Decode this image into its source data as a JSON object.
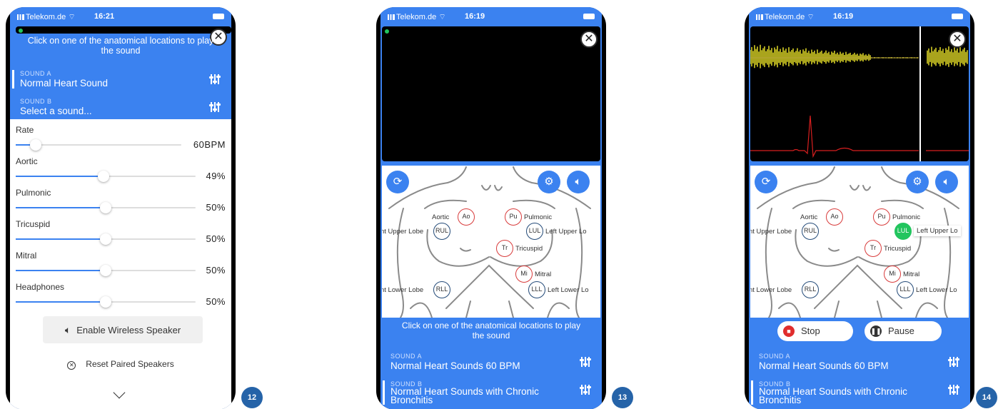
{
  "colors": {
    "accent": "#3b82f0",
    "badge": "#2563a8",
    "active_location": "#22c55e",
    "stop": "#e02d2d"
  },
  "screen12": {
    "status": {
      "carrier": "Telekom.de",
      "time": "16:21"
    },
    "instruction": "Click on one of the anatomical locations to play the sound",
    "sound_a": {
      "label": "SOUND A",
      "value": "Normal Heart Sound"
    },
    "sound_b": {
      "label": "SOUND B",
      "value": "Select a sound..."
    },
    "sliders": [
      {
        "label": "Rate",
        "value": "60BPM",
        "level": 0.12
      },
      {
        "label": "Aortic",
        "value": "49%",
        "level": 0.49
      },
      {
        "label": "Pulmonic",
        "value": "50%",
        "level": 0.5
      },
      {
        "label": "Tricuspid",
        "value": "50%",
        "level": 0.5
      },
      {
        "label": "Mitral",
        "value": "50%",
        "level": 0.5
      },
      {
        "label": "Headphones",
        "value": "50%",
        "level": 0.5
      }
    ],
    "wireless_button": "Enable Wireless Speaker",
    "reset_button": "Reset Paired Speakers",
    "step_badge": "12"
  },
  "screen13": {
    "status": {
      "carrier": "Telekom.de",
      "time": "16:19"
    },
    "locations": {
      "aortic": {
        "code": "Ao",
        "label": "Aortic"
      },
      "pulmonic": {
        "code": "Pu",
        "label": "Pulmonic"
      },
      "rul": {
        "code": "RUL",
        "label": "nt Upper Lobe"
      },
      "lul": {
        "code": "LUL",
        "label": "Left Upper Lo"
      },
      "tricuspid": {
        "code": "Tr",
        "label": "Tricuspid"
      },
      "mitral": {
        "code": "Mi",
        "label": "Mitral"
      },
      "rll": {
        "code": "RLL",
        "label": "nt Lower Lobe"
      },
      "lll": {
        "code": "LLL",
        "label": "Left Lower Lo"
      }
    },
    "instruction": "Click on one of the anatomical locations to play the sound",
    "sound_a": {
      "label": "SOUND A",
      "value": "Normal Heart Sounds 60 BPM"
    },
    "sound_b": {
      "label": "SOUND B",
      "value_line1": "Normal Heart Sounds with Chronic",
      "value_line2": "Bronchitis"
    },
    "step_badge": "13"
  },
  "screen14": {
    "status": {
      "carrier": "Telekom.de",
      "time": "16:19"
    },
    "locations": {
      "aortic": {
        "code": "Ao",
        "label": "Aortic"
      },
      "pulmonic": {
        "code": "Pu",
        "label": "Pulmonic"
      },
      "rul": {
        "code": "RUL",
        "label": "nt Upper Lobe"
      },
      "lul": {
        "code": "LUL",
        "label": "Left Upper Lo"
      },
      "tricuspid": {
        "code": "Tr",
        "label": "Tricuspid"
      },
      "mitral": {
        "code": "Mi",
        "label": "Mitral"
      },
      "rll": {
        "code": "RLL",
        "label": "nt Lower Lobe"
      },
      "lll": {
        "code": "LLL",
        "label": "Left Lower Lo"
      }
    },
    "stop_button": "Stop",
    "pause_button": "Pause",
    "sound_a": {
      "label": "SOUND A",
      "value": "Normal Heart Sounds 60 BPM"
    },
    "sound_b": {
      "label": "SOUND B",
      "value_line1": "Normal Heart Sounds with Chronic",
      "value_line2": "Bronchitis"
    },
    "step_badge": "14"
  }
}
